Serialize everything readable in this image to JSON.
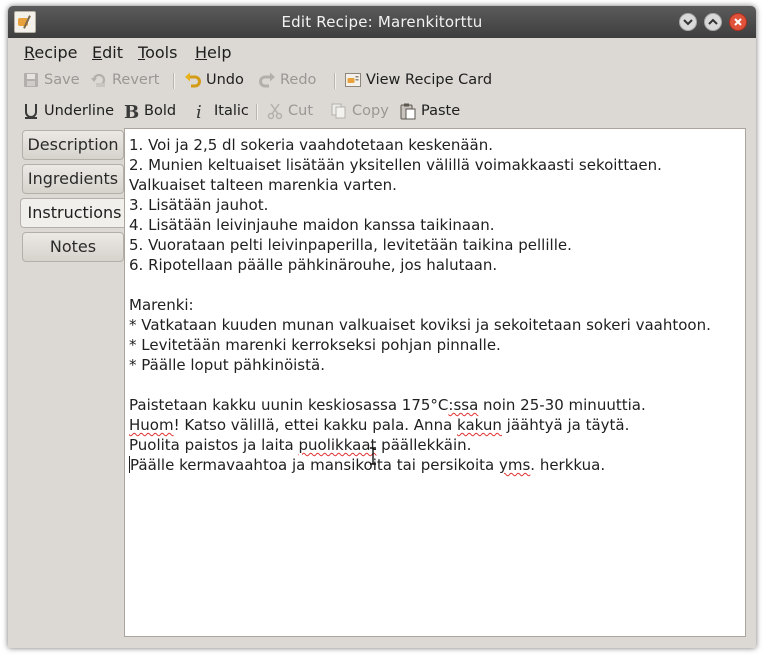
{
  "window": {
    "title": "Edit Recipe: Marenkitorttu"
  },
  "menubar": {
    "recipe": {
      "u": "R",
      "rest": "ecipe"
    },
    "edit": {
      "u": "E",
      "rest": "dit"
    },
    "tools": {
      "u": "T",
      "rest": "ools"
    },
    "help": {
      "u": "H",
      "rest": "elp"
    }
  },
  "toolbar1": {
    "save": "Save",
    "revert": "Revert",
    "undo": "Undo",
    "redo": "Redo",
    "view_recipe_card": "View Recipe Card"
  },
  "toolbar2": {
    "underline": "Underline",
    "bold": "Bold",
    "italic": "Italic",
    "cut": "Cut",
    "copy": "Copy",
    "paste": "Paste"
  },
  "tabs": [
    {
      "label": "Description",
      "active": false
    },
    {
      "label": "Ingredients",
      "active": false
    },
    {
      "label": "Instructions",
      "active": true
    },
    {
      "label": "Notes",
      "active": false
    }
  ],
  "instructions": {
    "l1": "1. Voi ja 2,5 dl sokeria vaahdotetaan keskenään.",
    "l2": "2. Munien keltuaiset lisätään yksitellen välillä voimakkaasti sekoittaen.",
    "l3": "Valkuaiset talteen marenkia varten.",
    "l4": "3. Lisätään jauhot.",
    "l5": "4. Lisätään leivinjauhe maidon kanssa taikinaan.",
    "l6": "5. Vuorataan pelti leivinpaperilla, levitetään taikina pellille.",
    "l7": "6. Ripotellaan päälle pähkinärouhe, jos halutaan.",
    "l8": "",
    "l9": "Marenki:",
    "l10": "* Vatkataan kuuden munan valkuaiset koviksi ja sekoitetaan sokeri vaahtoon.",
    "l11": "* Levitetään marenki kerrokseksi pohjan pinnalle.",
    "l12": "* Päälle loput pähkinöistä.",
    "l13": "",
    "l14a": "Paistetaan kakku uunin keskiosassa 175°C",
    "l14b": ":ssa",
    "l14c": " noin 25-30 minuuttia.",
    "l15a": "Huom",
    "l15b": "! Katso välillä, ettei kakku pala. Anna ",
    "l15c": "kakun",
    "l15d": " jäähtyä ja täytä.",
    "l16a": "Puolita paistos ja laita ",
    "l16b": "puolikkaat",
    "l16c": " päällekkäin.",
    "l17a": "Päälle kermavaahtoa ja mansikoita tai persikoita ",
    "l17b": "yms",
    "l17c": ". herkkua."
  },
  "colors": {
    "titlebar": "#4a4a4a",
    "window_bg": "#dcd9d4",
    "close_button": "#e0523a",
    "spellcheck": "#e03030"
  }
}
